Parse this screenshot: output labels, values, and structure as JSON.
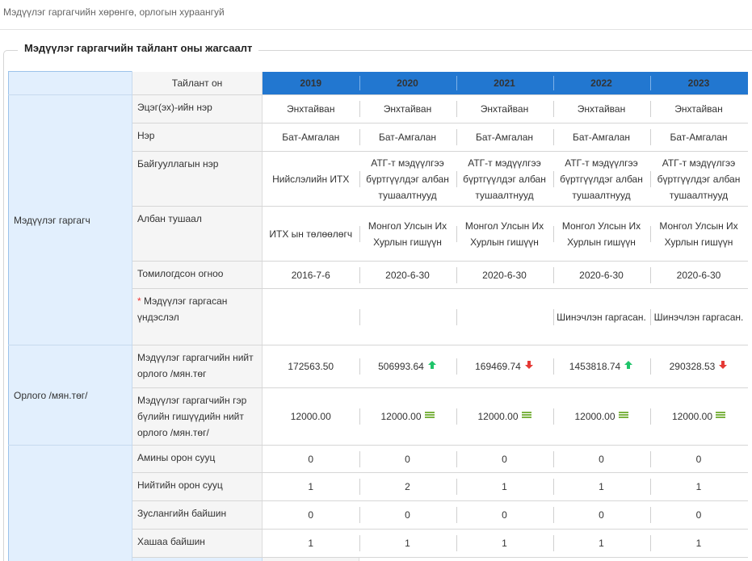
{
  "page": {
    "breadcrumb": "Мэдүүлэг гаргагчийн хөрөнгө, орлогын хураангуй"
  },
  "section": {
    "title": "Мэдүүлэг гаргагчийн тайлант оны жагсаалт"
  },
  "header": {
    "label": "Тайлант он",
    "years": [
      "2019",
      "2020",
      "2021",
      "2022",
      "2023"
    ]
  },
  "groups": {
    "declarant": "Мэдүүлэг гаргагч",
    "income": "Орлого /мян.төг/",
    "property": ""
  },
  "rows": {
    "father_name": {
      "label": "Эцэг(эх)-ийн нэр",
      "values": [
        "Энхтайван",
        "Энхтайван",
        "Энхтайван",
        "Энхтайван",
        "Энхтайван"
      ]
    },
    "name": {
      "label": "Нэр",
      "values": [
        "Бат-Амгалан",
        "Бат-Амгалан",
        "Бат-Амгалан",
        "Бат-Амгалан",
        "Бат-Амгалан"
      ]
    },
    "org": {
      "label": "Байгууллагын нэр",
      "values": [
        "Нийслэлийн ИТХ",
        "АТГ-т мэдүүлгээ бүртгүүлдэг албан тушаалтнууд",
        "АТГ-т мэдүүлгээ бүртгүүлдэг албан тушаалтнууд",
        "АТГ-т мэдүүлгээ бүртгүүлдэг албан тушаалтнууд",
        "АТГ-т мэдүүлгээ бүртгүүлдэг албан тушаалтнууд"
      ]
    },
    "position": {
      "label": "Албан тушаал",
      "values": [
        "ИТХ ын төлөөлөгч",
        "Монгол Улсын Их Хурлын гишүүн",
        "Монгол Улсын Их Хурлын гишүүн",
        "Монгол Улсын Их Хурлын гишүүн",
        "Монгол Улсын Их Хурлын гишүүн"
      ]
    },
    "appointed": {
      "label": "Томилогдсон огноо",
      "values": [
        "2016-7-6",
        "2020-6-30",
        "2020-6-30",
        "2020-6-30",
        "2020-6-30"
      ]
    },
    "reason": {
      "star": "*",
      "label": "Мэдүүлэг гаргасан үндэслэл",
      "values": [
        "",
        "",
        "",
        "Шинэчлэн гаргасан.",
        "Шинэчлэн гаргасан."
      ]
    },
    "total_income": {
      "label": "Мэдүүлэг гаргагчийн нийт орлого /мян.төг",
      "values": [
        "172563.50",
        "506993.64",
        "169469.74",
        "1453818.74",
        "290328.53"
      ],
      "trends": [
        "none",
        "up",
        "down",
        "up",
        "down"
      ]
    },
    "family_income": {
      "label": "Мэдүүлэг гаргагчийн гэр бүлийн гишүүдийн нийт орлого /мян.төг/",
      "values": [
        "12000.00",
        "12000.00",
        "12000.00",
        "12000.00",
        "12000.00"
      ],
      "trends": [
        "none",
        "equal",
        "equal",
        "equal",
        "equal"
      ]
    },
    "apartment": {
      "label": "Амины орон сууц",
      "values": [
        "0",
        "0",
        "0",
        "0",
        "0"
      ]
    },
    "public_housing": {
      "label": "Нийтийн орон сууц",
      "values": [
        "1",
        "2",
        "1",
        "1",
        "1"
      ]
    },
    "summer_house": {
      "label": "Зуслангийн байшин",
      "values": [
        "0",
        "0",
        "0",
        "0",
        "0"
      ]
    },
    "fenced_house": {
      "label": "Хашаа байшин",
      "values": [
        "1",
        "1",
        "1",
        "1",
        "1"
      ]
    }
  },
  "colors": {
    "header_blue": "#2277d0",
    "group_bg": "#e2effd",
    "up": "#1fc46a",
    "down": "#e53935",
    "equal": "#7cb342"
  },
  "icons": {
    "up": "arrow-up-icon",
    "down": "arrow-down-icon",
    "equal": "equal-icon"
  }
}
